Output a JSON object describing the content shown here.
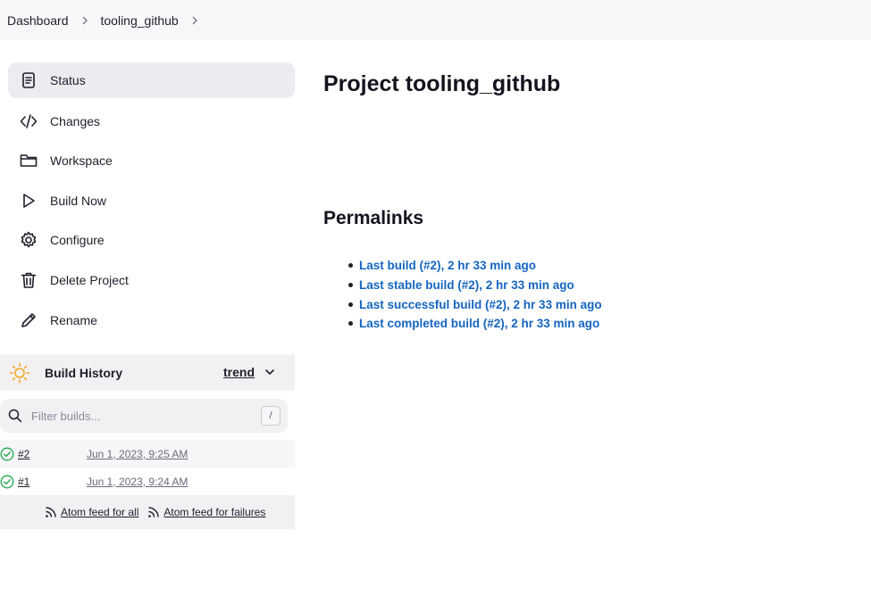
{
  "breadcrumb": {
    "items": [
      "Dashboard",
      "tooling_github"
    ]
  },
  "sidebar": {
    "tasks": [
      {
        "label": "Status",
        "icon": "status-icon",
        "active": true
      },
      {
        "label": "Changes",
        "icon": "code-icon"
      },
      {
        "label": "Workspace",
        "icon": "folder-icon"
      },
      {
        "label": "Build Now",
        "icon": "play-icon"
      },
      {
        "label": "Configure",
        "icon": "gear-icon"
      },
      {
        "label": "Delete Project",
        "icon": "trash-icon"
      },
      {
        "label": "Rename",
        "icon": "pencil-icon"
      }
    ]
  },
  "build_history": {
    "title": "Build History",
    "trend_label": "trend",
    "filter_placeholder": "Filter builds...",
    "shortcut_key": "/",
    "builds": [
      {
        "number": "#2",
        "time": "Jun 1, 2023, 9:25 AM",
        "status": "success"
      },
      {
        "number": "#1",
        "time": "Jun 1, 2023, 9:24 AM",
        "status": "success"
      }
    ],
    "feed_all": "Atom feed for all",
    "feed_failures": "Atom feed for failures"
  },
  "main": {
    "title": "Project tooling_github",
    "permalinks_title": "Permalinks",
    "permalinks": [
      "Last build (#2), 2 hr 33 min ago",
      "Last stable build (#2), 2 hr 33 min ago",
      "Last successful build (#2), 2 hr 33 min ago",
      "Last completed build (#2), 2 hr 33 min ago"
    ]
  },
  "colors": {
    "link": "#1565c0",
    "success": "#1ea64b",
    "sun": "#f5a623"
  }
}
